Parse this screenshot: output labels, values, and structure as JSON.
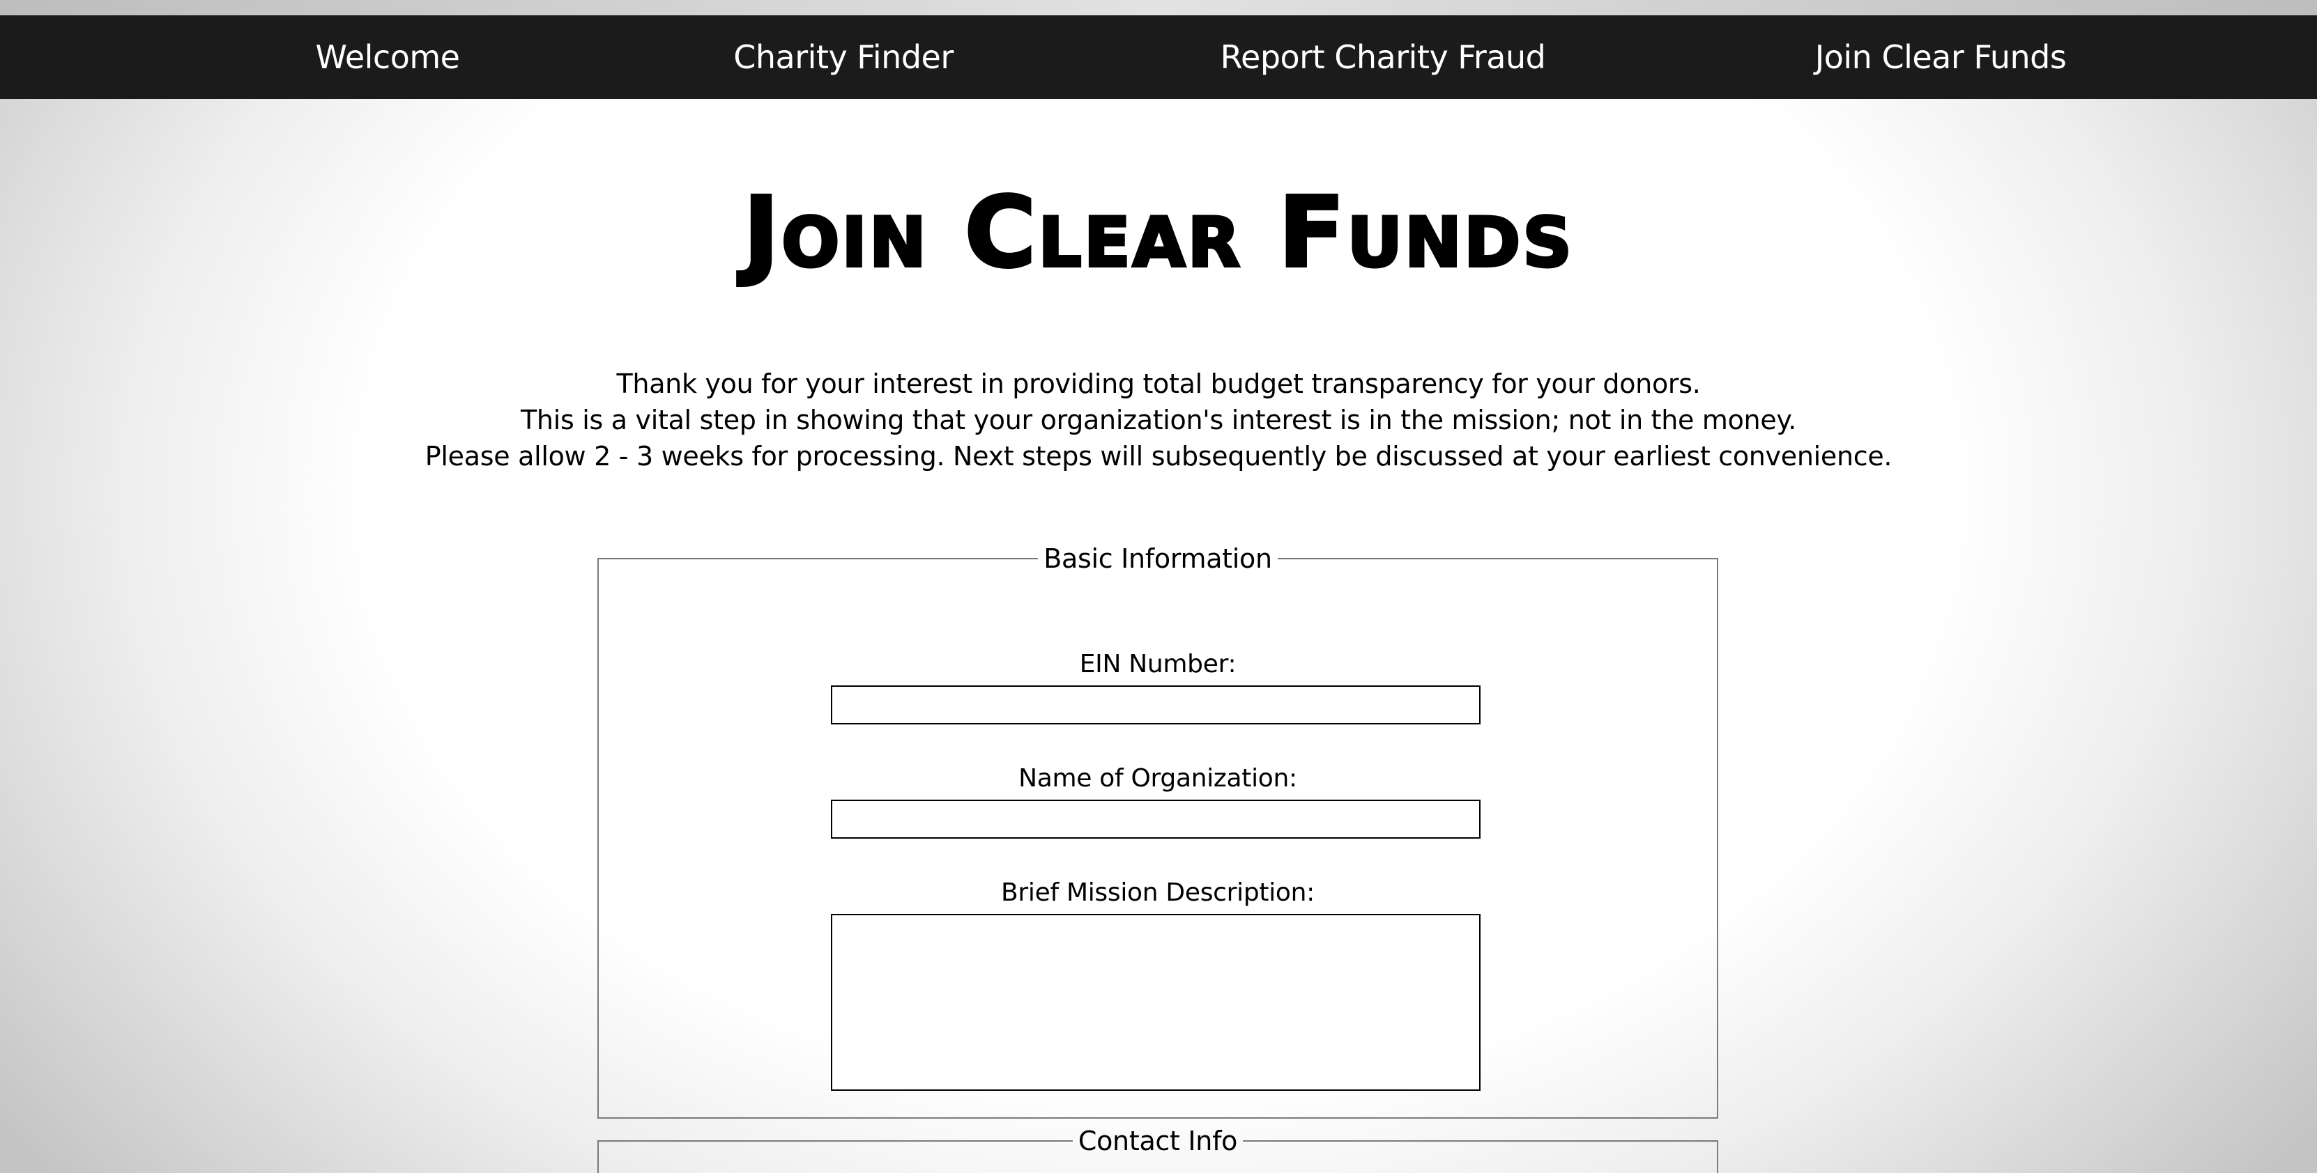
{
  "nav": {
    "items": [
      {
        "label": "Welcome"
      },
      {
        "label": "Charity Finder"
      },
      {
        "label": "Report Charity Fraud"
      },
      {
        "label": "Join Clear Funds"
      }
    ]
  },
  "page": {
    "title": "Join Clear Funds",
    "intro_lines": [
      "Thank you for your interest in providing total budget transparency for your donors.",
      "This is a vital step in showing that your organization's interest is in the mission; not in the money.",
      "Please allow 2 - 3 weeks for processing. Next steps will subsequently be discussed at your earliest convenience."
    ]
  },
  "form": {
    "basic_info": {
      "legend": "Basic Information",
      "ein_label": "EIN Number:",
      "ein_value": "",
      "org_name_label": "Name of Organization:",
      "org_name_value": "",
      "mission_label": "Brief Mission Description:",
      "mission_value": ""
    },
    "contact_info": {
      "legend": "Contact Info"
    }
  },
  "colors": {
    "navbar_bg": "#1b1b1b",
    "nav_text": "#ffffff",
    "page_bg": "#ffffff",
    "fieldset_border": "#7a7a7a"
  }
}
